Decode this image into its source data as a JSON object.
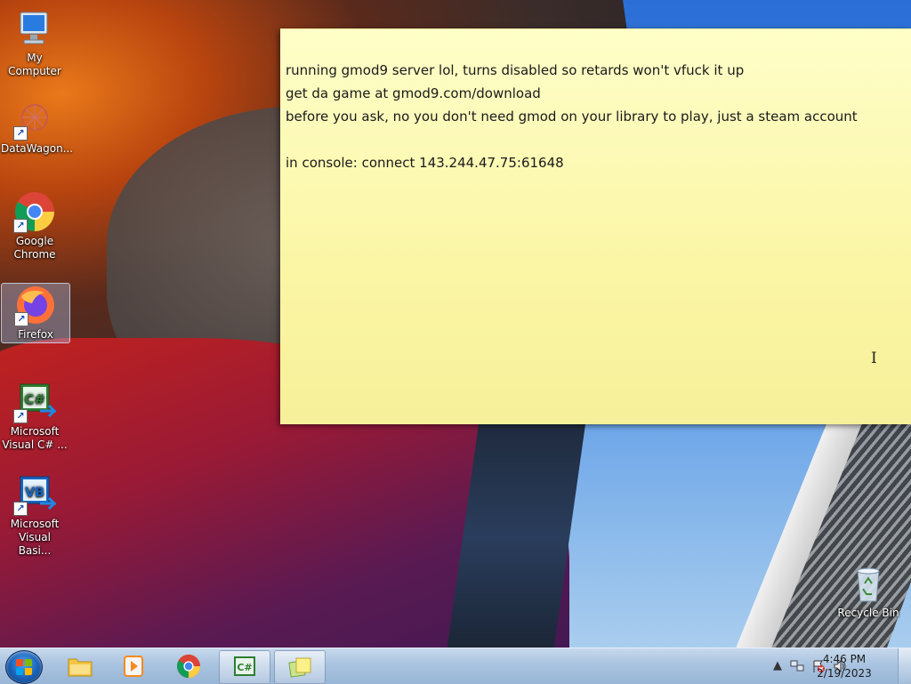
{
  "desktop_icons": [
    {
      "label": "My Computer",
      "icon": "computer-icon"
    },
    {
      "label": "DataWagon...",
      "icon": "datawagon-icon"
    },
    {
      "label": "Google Chrome",
      "icon": "chrome-icon"
    },
    {
      "label": "Firefox",
      "icon": "firefox-icon"
    },
    {
      "label": "Microsoft Visual C# ...",
      "icon": "visual-csharp-icon"
    },
    {
      "label": "Microsoft Visual Basi...",
      "icon": "visual-basic-icon"
    },
    {
      "label": "Recycle Bin",
      "icon": "recycle-bin-icon"
    }
  ],
  "sticky_note": {
    "lines": [
      "running gmod9 server lol, turns disabled so retards won't vfuck it up",
      "get da game at gmod9.com/download",
      "before you ask, no you don't need gmod on your library to play, just a steam account",
      "",
      "in console: connect 143.244.47.75:61648"
    ]
  },
  "taskbar": {
    "pinned": [
      {
        "name": "file-explorer-icon"
      },
      {
        "name": "media-player-icon"
      },
      {
        "name": "chrome-icon"
      },
      {
        "name": "visual-csharp-icon"
      },
      {
        "name": "sticky-notes-icon"
      }
    ],
    "clock": {
      "time": "4:46 PM",
      "date": "2/19/2023"
    }
  },
  "colors": {
    "sticky_bg": "#fbf6a5",
    "taskbar": "#a9c3e0"
  }
}
